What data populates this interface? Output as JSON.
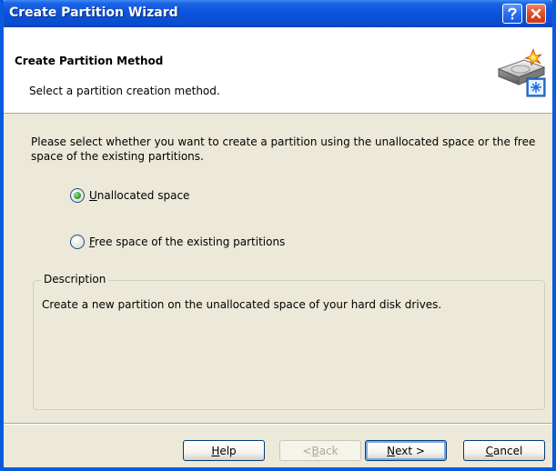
{
  "window": {
    "title": "Create Partition Wizard"
  },
  "header": {
    "title": "Create Partition Method",
    "subtitle": "Select a partition creation method."
  },
  "main": {
    "instructions": "Please select whether you want to create a partition using the unallocated space or the free space of the existing partitions.",
    "options": [
      {
        "accel": "U",
        "rest": "nallocated space",
        "selected": true
      },
      {
        "accel": "F",
        "rest": "ree space of the existing partitions",
        "selected": false
      }
    ],
    "description": {
      "legend": "Description",
      "text": "Create a new partition on the unallocated space of your hard disk drives."
    }
  },
  "buttons": {
    "help": {
      "accel": "H",
      "rest": "elp"
    },
    "back": {
      "pre": "< ",
      "accel": "B",
      "rest": "ack",
      "enabled": false
    },
    "next": {
      "accel": "N",
      "rest": "ext >",
      "default": true
    },
    "cancel": {
      "accel": "C",
      "rest": "ancel"
    }
  },
  "colors": {
    "titlebar": "#0a4fd6",
    "dialog_bg": "#ece9d8",
    "radio_selected": "#3aa83a",
    "close_button": "#e0502a"
  },
  "icons": {
    "help": "question-mark-icon",
    "close": "close-icon",
    "header": "hard-disk-sparkle-icon"
  }
}
